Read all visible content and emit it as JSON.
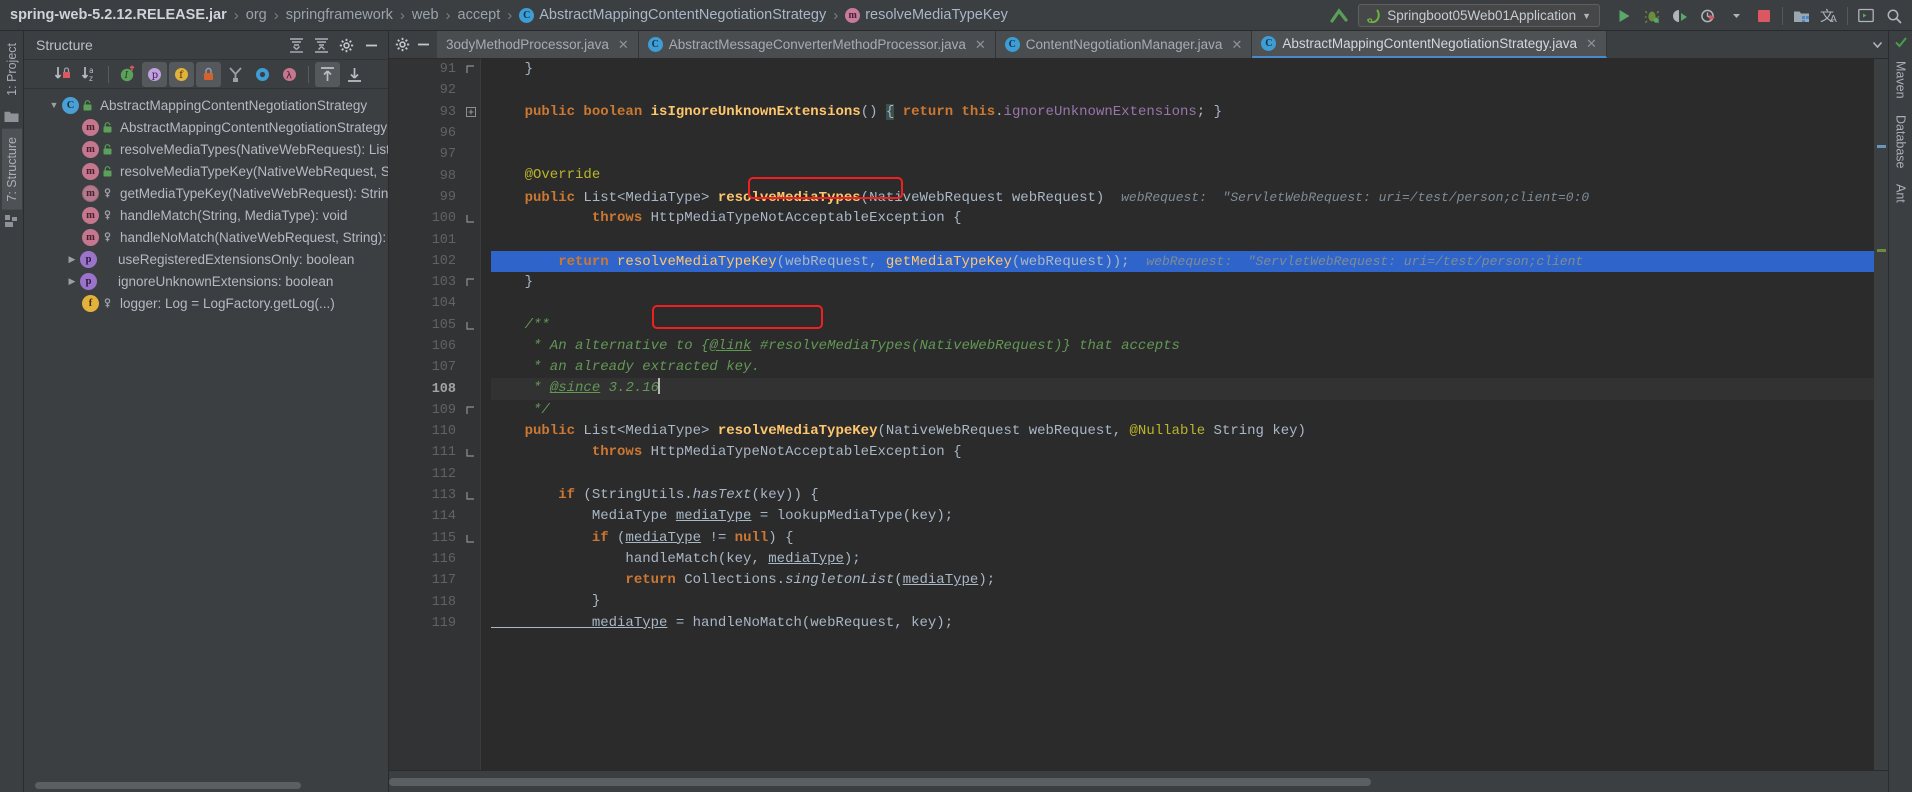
{
  "window": {
    "title": "AbstractMappingContentNegotiationStrategy.java - Springboot05Web01Application"
  },
  "breadcrumb": {
    "items": [
      {
        "label": "spring-web-5.2.12.RELEASE.jar",
        "icon": "jar-icon",
        "bold": true
      },
      {
        "label": "org",
        "icon": "package-icon",
        "bold": false
      },
      {
        "label": "springframework",
        "icon": "package-icon",
        "bold": false
      },
      {
        "label": "web",
        "icon": "package-icon",
        "bold": false
      },
      {
        "label": "accept",
        "icon": "package-icon",
        "bold": false
      },
      {
        "label": "AbstractMappingContentNegotiationStrategy",
        "icon": "class-icon",
        "bold": false
      },
      {
        "label": "resolveMediaTypeKey",
        "icon": "method-icon",
        "bold": false
      }
    ],
    "separator": "›"
  },
  "toolbar": {
    "run_config": "Springboot05Web01Application",
    "run_config_chevron": "▼",
    "buttons": [
      {
        "name": "run-button",
        "label": "Run"
      },
      {
        "name": "debug-button",
        "label": "Debug"
      },
      {
        "name": "run-with-coverage-button",
        "label": "Run with Coverage"
      },
      {
        "name": "profiler-button",
        "label": "Profiler"
      },
      {
        "name": "stop-button",
        "label": "Stop"
      },
      {
        "name": "project-structure-button",
        "label": "Project Structure"
      },
      {
        "name": "translate-button",
        "label": "Translate"
      },
      {
        "name": "terminal-button",
        "label": "Terminal"
      },
      {
        "name": "search-everywhere-button",
        "label": "Search Everywhere"
      }
    ]
  },
  "left_strip": {
    "tabs": [
      {
        "label": "1: Project",
        "selected": false
      },
      {
        "label": "7: Structure",
        "selected": true
      }
    ],
    "bottom_icon": "modules-icon"
  },
  "right_strip": {
    "tabs": [
      {
        "label": "Maven"
      },
      {
        "label": "Database"
      },
      {
        "label": "Ant"
      }
    ],
    "status_icon": "inspection-ok-icon"
  },
  "structure_panel": {
    "title": "Structure",
    "header_buttons": [
      {
        "name": "expand-all-button",
        "label": "Expand All"
      },
      {
        "name": "collapse-all-button",
        "label": "Collapse All"
      },
      {
        "name": "settings-button",
        "label": "Settings"
      },
      {
        "name": "hide-button",
        "label": "Hide"
      }
    ],
    "toolbar_buttons": [
      {
        "name": "sort-by-visibility-button",
        "label": "Sort by Visibility",
        "active": false
      },
      {
        "name": "sort-alphabetically-button",
        "label": "Sort Alphabetically",
        "active": false
      },
      {
        "name": "show-inherited-button",
        "label": "Show Inherited",
        "active": false
      },
      {
        "name": "show-properties-button",
        "label": "Show Properties",
        "active": true
      },
      {
        "name": "show-fields-button",
        "label": "Show Fields",
        "active": true
      },
      {
        "name": "show-non-public-button",
        "label": "Show Non-Public",
        "active": true
      },
      {
        "name": "group-methods-button",
        "label": "Group Methods by Defining Type",
        "active": false
      },
      {
        "name": "show-anonymous-classes-button",
        "label": "Show Anonymous Classes",
        "active": false
      },
      {
        "name": "show-lambdas-button",
        "label": "Show Lambdas",
        "active": false
      },
      {
        "name": "autoscroll-to-source-button",
        "label": "Autoscroll to Source",
        "active": true
      },
      {
        "name": "autoscroll-from-source-button",
        "label": "Autoscroll from Source",
        "active": false
      }
    ],
    "tree": [
      {
        "label": "AbstractMappingContentNegotiationStrategy",
        "icon": "class-icon",
        "visibility": "public-abstract",
        "indent": 0,
        "twisty": "expanded"
      },
      {
        "label": "AbstractMappingContentNegotiationStrategy(M",
        "icon": "method-icon",
        "visibility": "public",
        "indent": 1,
        "twisty": "none"
      },
      {
        "label": "resolveMediaTypes(NativeWebRequest): List<M",
        "icon": "method-icon",
        "visibility": "public",
        "indent": 1,
        "twisty": "none"
      },
      {
        "label": "resolveMediaTypeKey(NativeWebRequest, Strin",
        "icon": "method-icon",
        "visibility": "public",
        "indent": 1,
        "twisty": "none"
      },
      {
        "label": "getMediaTypeKey(NativeWebRequest): String",
        "icon": "method-abstract-icon",
        "visibility": "protected",
        "indent": 1,
        "twisty": "none"
      },
      {
        "label": "handleMatch(String, MediaType): void",
        "icon": "method-icon",
        "visibility": "protected",
        "indent": 1,
        "twisty": "none"
      },
      {
        "label": "handleNoMatch(NativeWebRequest, String): Me",
        "icon": "method-icon",
        "visibility": "protected",
        "indent": 1,
        "twisty": "none"
      },
      {
        "label": "useRegisteredExtensionsOnly: boolean",
        "icon": "property-icon",
        "visibility": "none",
        "indent": 0,
        "twisty": "collapsed"
      },
      {
        "label": "ignoreUnknownExtensions: boolean",
        "icon": "property-icon",
        "visibility": "none",
        "indent": 0,
        "twisty": "collapsed"
      },
      {
        "label": "logger: Log = LogFactory.getLog(...)",
        "icon": "static-field-icon",
        "visibility": "protected",
        "indent": 1,
        "twisty": "none"
      }
    ]
  },
  "editor_tabs": [
    {
      "label": "3odyMethodProcessor.java",
      "icon": "class-icon",
      "active": false,
      "truncated": true
    },
    {
      "label": "AbstractMessageConverterMethodProcessor.java",
      "icon": "class-icon",
      "active": false,
      "truncated": false
    },
    {
      "label": "ContentNegotiationManager.java",
      "icon": "class-icon",
      "active": false,
      "truncated": false
    },
    {
      "label": "AbstractMappingContentNegotiationStrategy.java",
      "icon": "class-icon",
      "active": true,
      "truncated": false
    }
  ],
  "editor": {
    "file_name": "AbstractMappingContentNegotiationStrategy.java",
    "current_line": 108,
    "selected_line": 102,
    "lines": [
      {
        "num": "91",
        "fold": "end",
        "tokens": [
          {
            "t": "plain",
            "v": "    }"
          }
        ]
      },
      {
        "num": "92",
        "fold": "none",
        "tokens": []
      },
      {
        "num": "93",
        "fold": "plus",
        "tokens": [
          {
            "t": "kw",
            "v": "    public "
          },
          {
            "t": "kw",
            "v": "boolean "
          },
          {
            "t": "mdecl",
            "v": "isIgnoreUnknownExtensions"
          },
          {
            "t": "plain",
            "v": "() "
          },
          {
            "t": "brace",
            "v": "{"
          },
          {
            "t": "kw",
            "v": " return "
          },
          {
            "t": "kw",
            "v": "this"
          },
          {
            "t": "plain",
            "v": "."
          },
          {
            "t": "fieldref",
            "v": "ignoreUnknownExtensions"
          },
          {
            "t": "plain",
            "v": "; }"
          }
        ]
      },
      {
        "num": "96",
        "fold": "none",
        "tokens": []
      },
      {
        "num": "97",
        "fold": "none",
        "tokens": []
      },
      {
        "num": "98",
        "fold": "none",
        "tokens": [
          {
            "t": "anno",
            "v": "    @Override"
          }
        ]
      },
      {
        "num": "99",
        "fold": "none",
        "gmark": "override-icon",
        "tokens": [
          {
            "t": "kw",
            "v": "    public "
          },
          {
            "t": "plain",
            "v": "List<MediaType> "
          },
          {
            "t": "mdecl",
            "v": "resolveMediaTypes"
          },
          {
            "t": "plain",
            "v": "(NativeWebRequest webRequest)  "
          },
          {
            "t": "hint",
            "v": "webRequest:  \"ServletWebRequest: uri=/test/person;client=0:0"
          }
        ]
      },
      {
        "num": "100",
        "fold": "start",
        "tokens": [
          {
            "t": "kw",
            "v": "            throws "
          },
          {
            "t": "plain",
            "v": "HttpMediaTypeNotAcceptableException {"
          }
        ]
      },
      {
        "num": "101",
        "fold": "none",
        "tokens": []
      },
      {
        "num": "102",
        "fold": "none",
        "selected": true,
        "tokens": [
          {
            "t": "kw",
            "v": "        return "
          },
          {
            "t": "mcall",
            "v": "resolveMediaTypeKey"
          },
          {
            "t": "plain",
            "v": "(webRequest, "
          },
          {
            "t": "mcall",
            "v": "getMediaTypeKey"
          },
          {
            "t": "plain",
            "v": "(webRequest));  "
          },
          {
            "t": "hint",
            "v": "webRequest:  \"ServletWebRequest: uri=/test/person;client"
          }
        ]
      },
      {
        "num": "103",
        "fold": "end",
        "tokens": [
          {
            "t": "plain",
            "v": "    }"
          }
        ]
      },
      {
        "num": "104",
        "fold": "none",
        "tokens": []
      },
      {
        "num": "105",
        "fold": "start",
        "gmark": "javadoc-icon",
        "tokens": [
          {
            "t": "cmt",
            "v": "    /**"
          }
        ]
      },
      {
        "num": "106",
        "fold": "none",
        "tokens": [
          {
            "t": "cmt",
            "v": "     * An alternative to {"
          },
          {
            "t": "cmtlink",
            "v": "@link"
          },
          {
            "t": "cmt",
            "v": " #resolveMediaTypes(NativeWebRequest)} that accepts"
          }
        ]
      },
      {
        "num": "107",
        "fold": "none",
        "tokens": [
          {
            "t": "cmt",
            "v": "     * an already extracted key."
          }
        ]
      },
      {
        "num": "108",
        "fold": "none",
        "current": true,
        "tokens": [
          {
            "t": "cmt",
            "v": "     * "
          },
          {
            "t": "cmtlink",
            "v": "@since"
          },
          {
            "t": "cmt",
            "v": " 3.2.16"
          },
          {
            "t": "caret",
            "v": ""
          }
        ]
      },
      {
        "num": "109",
        "fold": "end",
        "tokens": [
          {
            "t": "cmt",
            "v": "     */"
          }
        ]
      },
      {
        "num": "110",
        "fold": "none",
        "tokens": [
          {
            "t": "kw",
            "v": "    public "
          },
          {
            "t": "plain",
            "v": "List<MediaType> "
          },
          {
            "t": "mdecl",
            "v": "resolveMediaTypeKey"
          },
          {
            "t": "plain",
            "v": "(NativeWebRequest webRequest, "
          },
          {
            "t": "anno",
            "v": "@Nullable "
          },
          {
            "t": "plain",
            "v": "String key)"
          }
        ]
      },
      {
        "num": "111",
        "fold": "start",
        "tokens": [
          {
            "t": "kw",
            "v": "            throws "
          },
          {
            "t": "plain",
            "v": "HttpMediaTypeNotAcceptableException {"
          }
        ]
      },
      {
        "num": "112",
        "fold": "none",
        "tokens": []
      },
      {
        "num": "113",
        "fold": "start",
        "tokens": [
          {
            "t": "kw",
            "v": "        if "
          },
          {
            "t": "plain",
            "v": "(StringUtils."
          },
          {
            "t": "italicref",
            "v": "hasText"
          },
          {
            "t": "plain",
            "v": "(key)) {"
          }
        ]
      },
      {
        "num": "114",
        "fold": "none",
        "tokens": [
          {
            "t": "plain",
            "v": "            MediaType "
          },
          {
            "t": "localvar",
            "v": "mediaType"
          },
          {
            "t": "plain",
            "v": " = "
          },
          {
            "t": "mcall",
            "v": "lookupMediaType"
          },
          {
            "t": "plain",
            "v": "(key);"
          }
        ]
      },
      {
        "num": "115",
        "fold": "start",
        "tokens": [
          {
            "t": "kw",
            "v": "            if "
          },
          {
            "t": "plain",
            "v": "("
          },
          {
            "t": "localvar",
            "v": "mediaType"
          },
          {
            "t": "plain",
            "v": " != "
          },
          {
            "t": "kw",
            "v": "null"
          },
          {
            "t": "plain",
            "v": ") {"
          }
        ]
      },
      {
        "num": "116",
        "fold": "none",
        "tokens": [
          {
            "t": "mcall",
            "v": "                handleMatch"
          },
          {
            "t": "plain",
            "v": "(key, "
          },
          {
            "t": "localvar",
            "v": "mediaType"
          },
          {
            "t": "plain",
            "v": ");"
          }
        ]
      },
      {
        "num": "117",
        "fold": "none",
        "tokens": [
          {
            "t": "kw",
            "v": "                return "
          },
          {
            "t": "plain",
            "v": "Collections."
          },
          {
            "t": "italicref",
            "v": "singletonList"
          },
          {
            "t": "plain",
            "v": "("
          },
          {
            "t": "localvar",
            "v": "mediaType"
          },
          {
            "t": "plain",
            "v": ");"
          }
        ]
      },
      {
        "num": "118",
        "fold": "end",
        "tokens": [
          {
            "t": "plain",
            "v": "            }"
          }
        ]
      },
      {
        "num": "119",
        "fold": "none",
        "tokens": [
          {
            "t": "localvar",
            "v": "            mediaType"
          },
          {
            "t": "plain",
            "v": " = "
          },
          {
            "t": "mcall",
            "v": "handleNoMatch"
          },
          {
            "t": "plain",
            "v": "(webRequest, key);"
          }
        ]
      }
    ],
    "annotations": [
      {
        "name": "red-highlight-box-resolve-media-types",
        "line": "99",
        "label": "resolveMediaTypes("
      },
      {
        "name": "red-highlight-box-resolve-media-type-key",
        "line": "102",
        "label": "resolveMediaTypeKey("
      }
    ]
  },
  "colors": {
    "accent_red": "#f02020",
    "selection_blue": "#2f65ca",
    "keyword_orange": "#cc7832",
    "method_yellow": "#ffc66d",
    "comment_green": "#629755",
    "annotation_yellow": "#bbb529",
    "background": "#2b2b2b",
    "chrome": "#3c3f41"
  }
}
